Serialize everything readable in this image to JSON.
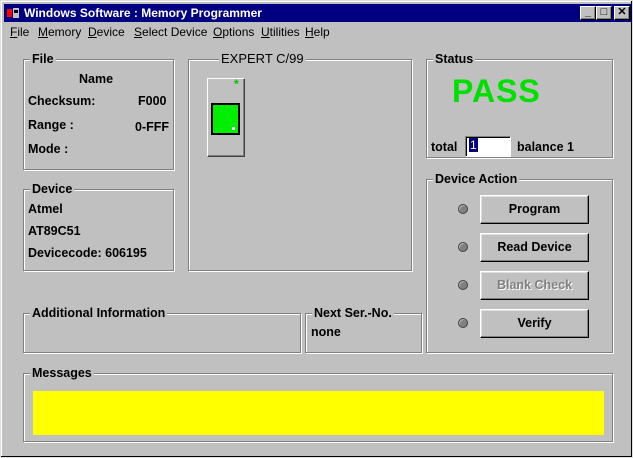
{
  "window": {
    "title": "Windows Software :  Memory Programmer",
    "controls": {
      "minimize": "_",
      "maximize": "□",
      "close": "✕"
    }
  },
  "menu": [
    "File",
    "Memory",
    "Device",
    "Select Device",
    "Options",
    "Utilities",
    "Help"
  ],
  "file": {
    "title": "File",
    "name_label": "Name",
    "checksum_label": "Checksum:",
    "checksum_value": "F000",
    "range_label": "Range :",
    "range_value": "0-FFF",
    "mode_label": "Mode :"
  },
  "device": {
    "title": "Device",
    "manufacturer": "Atmel",
    "part": "AT89C51",
    "devicecode": "Devicecode: 606195"
  },
  "programmer": {
    "title": "EXPERT  C/99",
    "indicator": "*"
  },
  "status": {
    "title": "Status",
    "result": "PASS",
    "total_label": "total",
    "total_value": "1",
    "balance": "balance 1"
  },
  "device_action": {
    "title": "Device Action",
    "buttons": [
      {
        "label": "Program",
        "enabled": true
      },
      {
        "label": "Read Device",
        "enabled": true
      },
      {
        "label": "Blank Check",
        "enabled": false
      },
      {
        "label": "Verify",
        "enabled": true
      }
    ]
  },
  "additional_info": {
    "title": "Additional Information"
  },
  "next_serial": {
    "title": "Next Ser.-No.",
    "value": "none"
  },
  "messages": {
    "title": "Messages"
  },
  "colors": {
    "titlebar": "#000080",
    "pass": "#00e000",
    "chip": "#00ee00",
    "messages_bg": "#ffff00"
  }
}
